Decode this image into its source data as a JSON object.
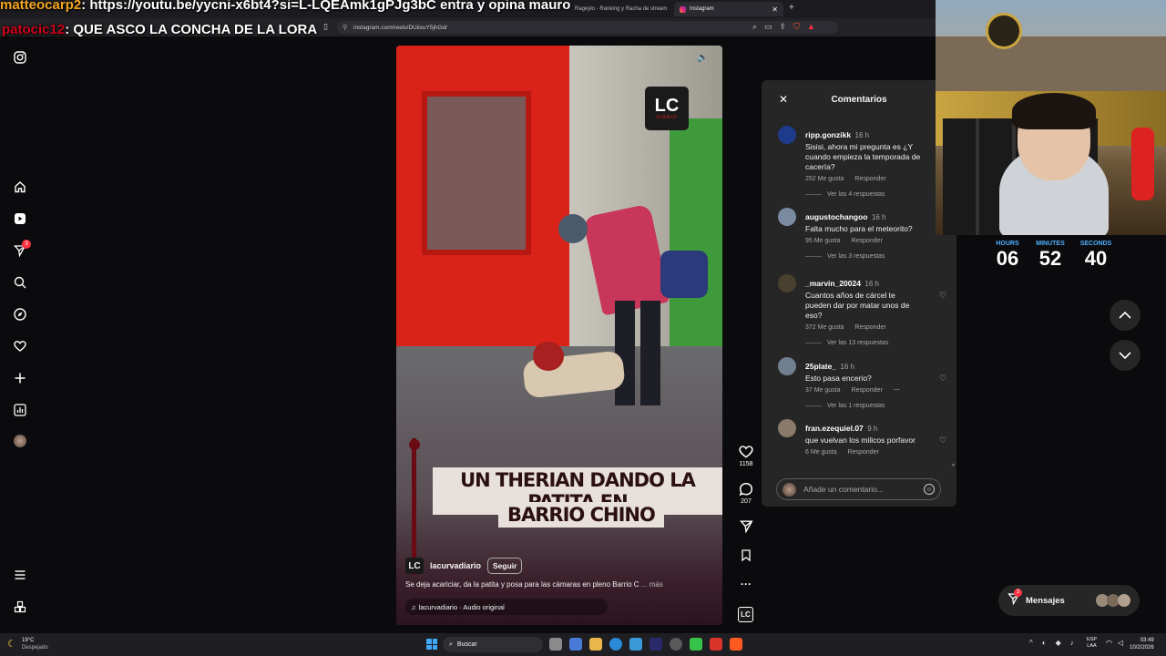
{
  "browser": {
    "tabs": [
      {
        "label": "Rageylo - Ranking y Racha de stream"
      },
      {
        "label": "Instagram"
      }
    ],
    "url": "instagram.com/reels/DUiixuY5jhGd/"
  },
  "chat_overlay": [
    {
      "user": "matteocarp2",
      "sep": ": ",
      "message": "https://youtu.be/yycni-x6bt4?si=L-LQEAmk1gPJg3bC entra y opina mauro"
    },
    {
      "user": "patocic12",
      "sep": ": ",
      "message": "QUE ASCO LA CONCHA DE LA LORA"
    }
  ],
  "nav": {
    "messages_badge": "3"
  },
  "video": {
    "logo_text": "LC",
    "logo_sub": "DIARIO",
    "caption_line1": "UN THERIAN DANDO LA PATITA EN",
    "caption_line2": "BARRIO CHINO",
    "author": "lacurvadiario",
    "follow_label": "Seguir",
    "description": "Se deja acariciar, da la patita y posa para las cámaras en pleno Barrio C",
    "more_label": "... más",
    "audio": "lacurvadiario · Audio original"
  },
  "actions": {
    "likes": "1158",
    "comments": "207",
    "bottom_logo": "LC"
  },
  "comments": {
    "title": "Comentarios",
    "input_placeholder": "Añade un comentario...",
    "like_label": "Me gusta",
    "reply_label": "Responder",
    "items": [
      {
        "user": "ripp.gonzikk",
        "time": "16 h",
        "text": "Sisisi, ahora mi pregunta es ¿Y cuando empieza la temporada de cacería?",
        "likes": "252 Me gusta",
        "replies": "Ver las 4 respuestas",
        "color": "#1e3a8a"
      },
      {
        "user": "augustochangoo",
        "time": "16 h",
        "text": "Falta mucho para el meteorito?",
        "likes": "95 Me gusta",
        "replies": "Ver las 3 respuestas",
        "color": "#7a8aa0"
      },
      {
        "user": "_marvin_20024",
        "time": "16 h",
        "text": "Cuantos años de cárcel te pueden dar por matar unos de eso?",
        "likes": "372 Me gusta",
        "replies": "Ver las 13 respuestas",
        "color": "#4a4030"
      },
      {
        "user": "25plate_",
        "time": "16 h",
        "text": "Esto pasa encerio?",
        "likes": "37 Me gusta",
        "replies": "Ver las 1 respuestas",
        "color": "#6f7f8f"
      },
      {
        "user": "fran.ezequiel.07",
        "time": "9 h",
        "text": "que vuelvan los milicos porfavor",
        "likes": "6 Me gusta",
        "replies": "",
        "color": "#8a7a6a"
      }
    ]
  },
  "timer": {
    "hours_label": "HOURS",
    "minutes_label": "MINUTES",
    "seconds_label": "SECONDS",
    "hours": "06",
    "minutes": "52",
    "seconds": "40"
  },
  "messages_button": {
    "label": "Mensajes",
    "badge": "3"
  },
  "taskbar": {
    "weather_temp": "19°C",
    "weather_desc": "Despejado",
    "search_label": "Buscar",
    "lang_top": "ESP",
    "lang_bottom": "LAA",
    "time": "03:49",
    "date": "10/2/2026"
  },
  "colors": {
    "accent_blue": "#4fb0ff",
    "badge_red": "#ff3040",
    "panel_bg": "#262626",
    "video_red": "#e0201a"
  }
}
